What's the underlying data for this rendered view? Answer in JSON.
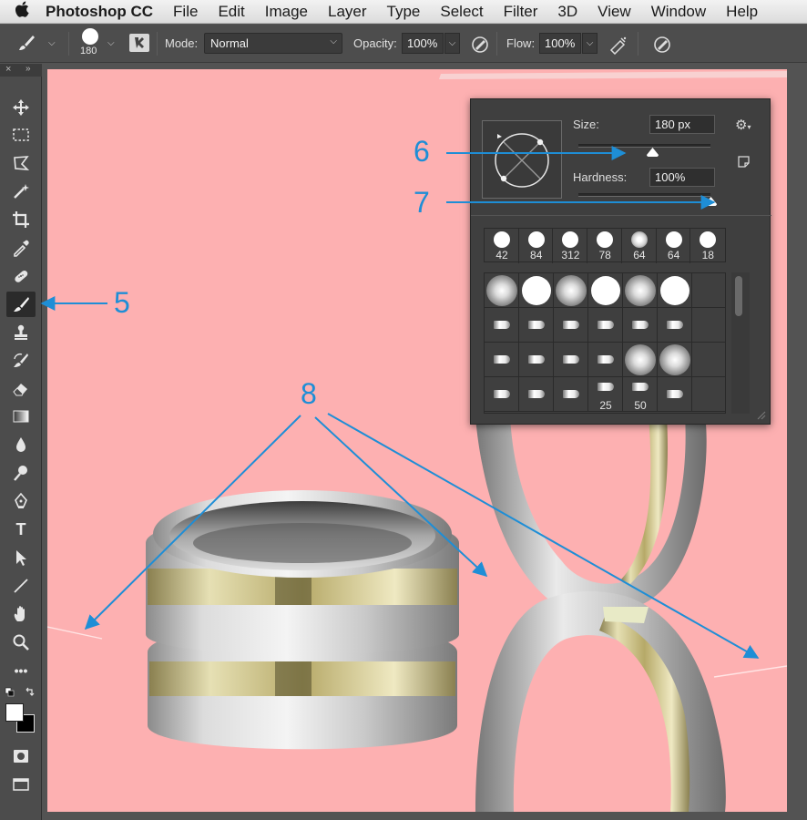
{
  "menubar": {
    "apple_icon": "apple-logo",
    "app_name": "Photoshop CC",
    "items": [
      "File",
      "Edit",
      "Image",
      "Layer",
      "Type",
      "Select",
      "Filter",
      "3D",
      "View",
      "Window",
      "Help"
    ]
  },
  "options_bar": {
    "brush_size": "180",
    "mode_label": "Mode:",
    "mode_value": "Normal",
    "opacity_label": "Opacity:",
    "opacity_value": "100%",
    "flow_label": "Flow:",
    "flow_value": "100%"
  },
  "toolbox": {
    "type_tool_glyph": "T",
    "more_tools_glyph": "•••"
  },
  "brush_panel": {
    "size_label": "Size:",
    "size_value": "180 px",
    "size_level": 0.56,
    "hardness_label": "Hardness:",
    "hardness_value": "100%",
    "hardness_level": 1.0,
    "recent_brushes": [
      {
        "size": "42",
        "soft": false
      },
      {
        "size": "84",
        "soft": false
      },
      {
        "size": "312",
        "soft": false
      },
      {
        "size": "78",
        "soft": false
      },
      {
        "size": "64",
        "soft": true
      },
      {
        "size": "64",
        "soft": false
      },
      {
        "size": "18",
        "soft": false
      }
    ],
    "preset_grid_numbers": [
      "25",
      "50"
    ]
  },
  "annotations": {
    "callout_5": "5",
    "callout_6": "6",
    "callout_7": "7",
    "callout_8": "8",
    "color": "#1e8ed6"
  },
  "colors": {
    "canvas_background": "#fdb0b1",
    "panel_background": "#3f3f3f",
    "toolbox_background": "#4c4c4c"
  }
}
